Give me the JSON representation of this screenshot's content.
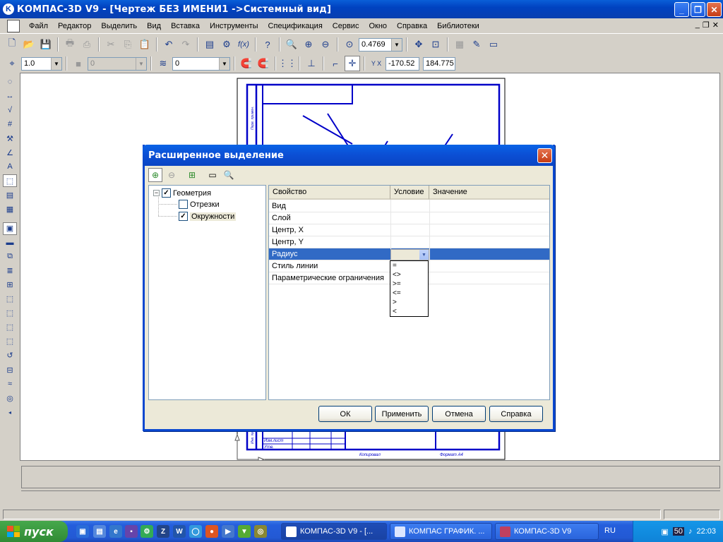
{
  "window": {
    "title": "КОМПАС-3D V9 - [Чертеж БЕЗ ИМЕНИ1 ->Системный вид]"
  },
  "menu": [
    "Файл",
    "Редактор",
    "Выделить",
    "Вид",
    "Вставка",
    "Инструменты",
    "Спецификация",
    "Сервис",
    "Окно",
    "Справка",
    "Библиотеки"
  ],
  "toolbar1": {
    "zoom_value": "0.4769"
  },
  "toolbar2": {
    "scale_value": "1.0",
    "style_value": "0",
    "layer_value": "0",
    "coord_x": "-170.52",
    "coord_y": "184.775",
    "coord_label": "Y X"
  },
  "drawing": {
    "stamp_labels": [
      "Копировал",
      "Формат   А4",
      "Изм.лист",
      "Утв.",
      "Перв. примен.",
      "Инв. № подл."
    ]
  },
  "dialog": {
    "title": "Расширенное выделение",
    "tree": {
      "root": {
        "label": "Геометрия",
        "checked": true
      },
      "children": [
        {
          "label": "Отрезки",
          "checked": false
        },
        {
          "label": "Окружности",
          "checked": true
        }
      ]
    },
    "grid": {
      "headers": [
        "Свойство",
        "Условие",
        "Значение"
      ],
      "rows": [
        "Вид",
        "Слой",
        "Центр, X",
        "Центр, Y",
        "Радиус",
        "Стиль линии",
        "Параметрические ограничения"
      ],
      "selected_row": "Радиус"
    },
    "condition_options": [
      "=",
      "<>",
      ">=",
      "<=",
      ">",
      "<"
    ],
    "buttons": {
      "ok": "ОК",
      "apply": "Применить",
      "cancel": "Отмена",
      "help": "Справка"
    }
  },
  "taskbar": {
    "start_label": "пуск",
    "tasks": [
      "КОМПАС-3D V9 - [...",
      "КОМПАС ГРАФИК. ...",
      "КОМПАС-3D V9"
    ],
    "language": "RU",
    "clock": "22:03",
    "tray_badge": "50"
  },
  "colors": {
    "accent": "#0a48d0",
    "drawing_lines": "#0000c8",
    "selection": "#316ac5"
  }
}
